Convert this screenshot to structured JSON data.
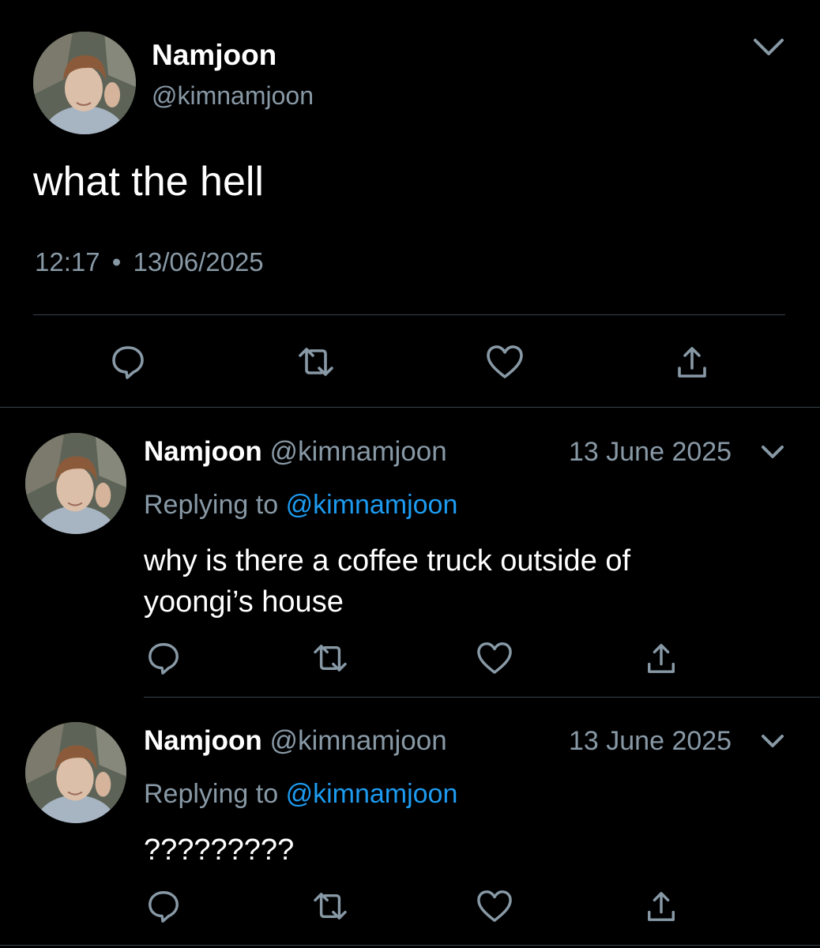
{
  "main_tweet": {
    "name": "Namjoon",
    "handle": "@kimnamjoon",
    "text": "what the hell",
    "time": "12:17",
    "separator": "•",
    "date": "13/06/2025",
    "actions": [
      "reply-icon",
      "retweet-icon",
      "like-icon",
      "share-icon"
    ]
  },
  "replies": [
    {
      "name": "Namjoon",
      "handle": "@kimnamjoon",
      "date": "13 June 2025",
      "replying_prefix": "Replying to",
      "replying_to": "@kimnamjoon",
      "text": "why is there a coffee truck outside of yoongi’s house"
    },
    {
      "name": "Namjoon",
      "handle": "@kimnamjoon",
      "date": "13 June 2025",
      "replying_prefix": "Replying to",
      "replying_to": "@kimnamjoon",
      "text": "?????????"
    }
  ],
  "colors": {
    "background": "#000000",
    "text": "#ffffff",
    "secondary": "#8899a6",
    "link": "#1d9bf0",
    "divider": "#38444d"
  }
}
